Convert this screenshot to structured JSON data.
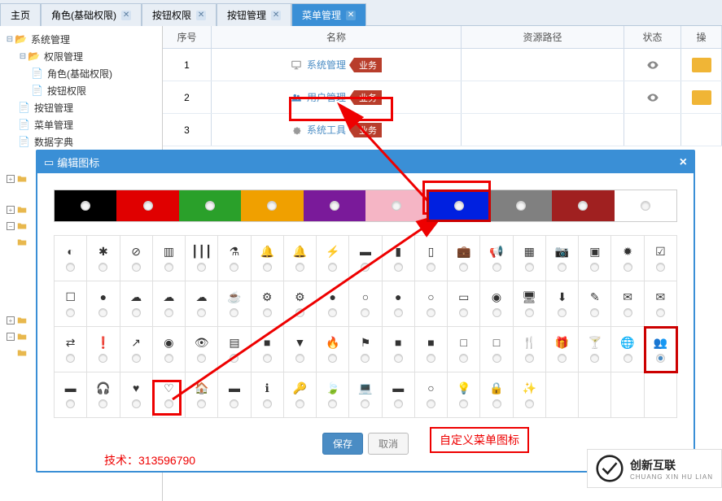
{
  "tabs": [
    {
      "label": "主页",
      "closable": false,
      "active": false
    },
    {
      "label": "角色(基础权限)",
      "closable": true,
      "active": false
    },
    {
      "label": "按钮权限",
      "closable": true,
      "active": false
    },
    {
      "label": "按钮管理",
      "closable": true,
      "active": false
    },
    {
      "label": "菜单管理",
      "closable": true,
      "active": true
    }
  ],
  "tree": {
    "root": {
      "label": "系统管理"
    },
    "perm": {
      "label": "权限管理"
    },
    "role": {
      "label": "角色(基础权限)"
    },
    "btnperm": {
      "label": "按钮权限"
    },
    "btnmgr": {
      "label": "按钮管理"
    },
    "menumgr": {
      "label": "菜单管理"
    },
    "dict": {
      "label": "数据字典"
    }
  },
  "grid": {
    "headers": {
      "num": "序号",
      "name": "名称",
      "path": "资源路径",
      "status": "状态",
      "action": "操"
    },
    "rows": [
      {
        "num": "1",
        "name": "系统管理",
        "badge": "业务",
        "icon": "desktop"
      },
      {
        "num": "2",
        "name": "用户管理",
        "badge": "业务",
        "icon": "users"
      },
      {
        "num": "3",
        "name": "系统工具",
        "badge": "业务",
        "icon": "gear"
      }
    ]
  },
  "modal": {
    "title": "编辑图标",
    "colors": [
      "#000000",
      "#e00000",
      "#2aa02a",
      "#f0a000",
      "#7a1a9a",
      "#f5b5c5",
      "#0020e0",
      "#808080",
      "#a02020",
      "#ffffff"
    ],
    "selected_color_index": 6,
    "icons": [
      "adjust",
      "asterisk",
      "ban",
      "bar-chart",
      "barcode",
      "beaker",
      "bell",
      "bell-alt",
      "bolt",
      "book",
      "bookmark",
      "bookmark-o",
      "briefcase",
      "bullhorn",
      "calendar",
      "camera",
      "camera-retro",
      "certificate",
      "check",
      "check-empty",
      "circle",
      "cloud",
      "cloud-download",
      "cloud-upload",
      "coffee",
      "cog",
      "cogs",
      "comment",
      "comment-o",
      "comments",
      "comments-o",
      "credit-card",
      "dashboard",
      "desktop",
      "download",
      "edit",
      "envelope",
      "envelope-o",
      "exchange",
      "exclamation",
      "external",
      "eye-slash",
      "eye",
      "film",
      "facetime",
      "filter",
      "fire",
      "flag",
      "folder",
      "folder-open",
      "folder-o",
      "folder-open-o",
      "food",
      "gift",
      "glass",
      "globe",
      "group",
      "hdd",
      "headphones",
      "heart",
      "heart-o",
      "home",
      "inbox",
      "info",
      "key",
      "leaf",
      "laptop",
      "legal",
      "lemon",
      "lightbulb",
      "lock",
      "magic"
    ],
    "selected_icon": "group",
    "save_label": "保存",
    "cancel_label": "取消"
  },
  "annotations": {
    "custom_label": "自定义菜单图标",
    "tech_text": "技术：313596790"
  },
  "watermark": {
    "name": "创新互联",
    "sub": "CHUANG XIN HU LIAN"
  }
}
